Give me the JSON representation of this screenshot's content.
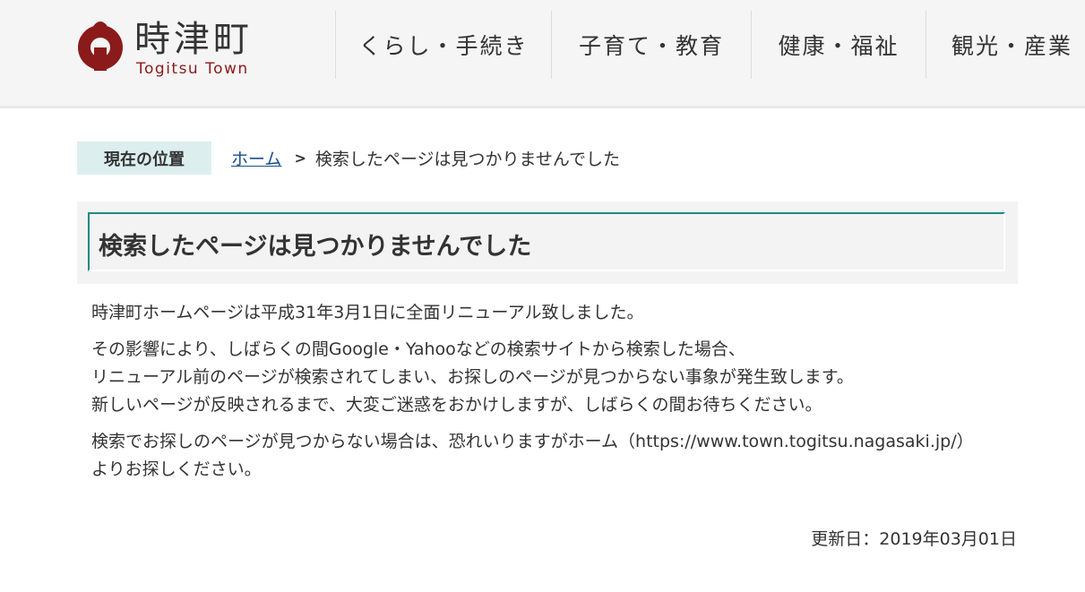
{
  "header": {
    "logo": {
      "kanji": "時津町",
      "roman": "Togitsu Town",
      "brand_color": "#8b1a1a",
      "icon": "town-emblem-icon"
    },
    "nav": [
      {
        "label": "くらし・手続き"
      },
      {
        "label": "子育て・教育"
      },
      {
        "label": "健康・福祉"
      },
      {
        "label": "観光・産業"
      }
    ]
  },
  "breadcrumb": {
    "label": "現在の位置",
    "home": "ホーム",
    "separator": ">",
    "current": "検索したページは見つかりませんでした"
  },
  "main": {
    "title": "検索したページは見つかりませんでした",
    "paragraphs": [
      {
        "lines": [
          "時津町ホームページは平成31年3月1日に全面リニューアル致しました。"
        ]
      },
      {
        "lines": [
          "その影響により、しばらくの間Google・Yahooなどの検索サイトから検索した場合、",
          "リニューアル前のページが検索されてしまい、お探しのページが見つからない事象が発生致します。",
          "新しいページが反映されるまで、大変ご迷惑をおかけしますが、しばらくの間お待ちください。"
        ]
      },
      {
        "lines": [
          "検索でお探しのページが見つからない場合は、恐れいりますがホーム（https://www.town.togitsu.nagasaki.jp/）",
          "よりお探しください。"
        ]
      }
    ],
    "updated": "更新日：2019年03月01日"
  },
  "colors": {
    "accent": "#1d8a84",
    "breadcrumb_label_bg": "#dcefee",
    "link": "#1a4f8a",
    "header_bg": "#f5f5f5"
  }
}
